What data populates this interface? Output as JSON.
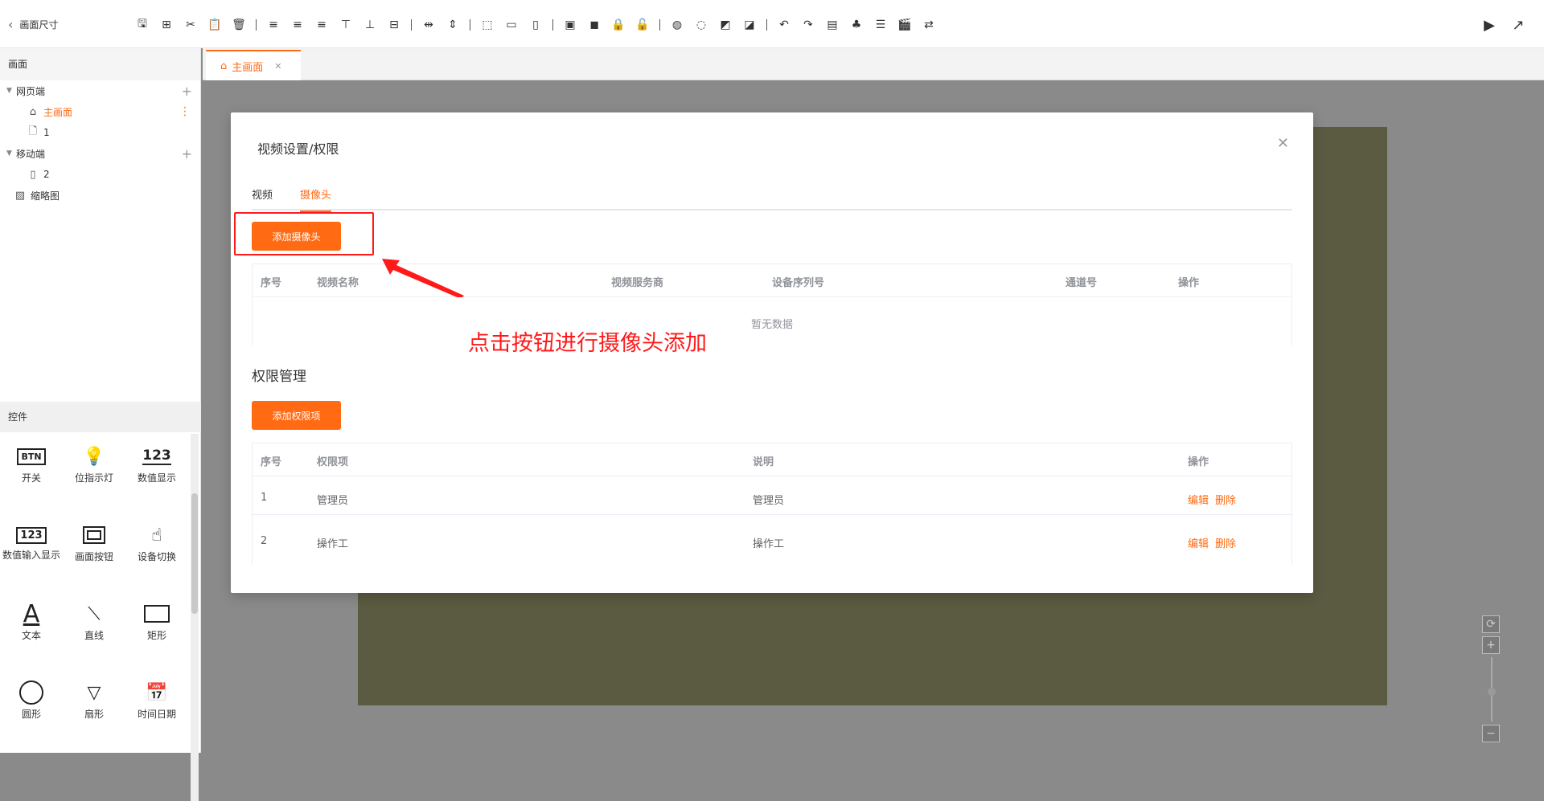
{
  "toolbar": {
    "back_label": "画面尺寸"
  },
  "left_panel": {
    "pages_title": "画面",
    "tree": {
      "web_label": "网页端",
      "main_page_label": "主画面",
      "page1_label": "1",
      "mobile_label": "移动端",
      "mobile_page_label": "2",
      "thumbnail_label": "缩略图"
    },
    "controls_title": "控件",
    "controls": [
      {
        "label": "开关",
        "icon": "btn-icon"
      },
      {
        "label": "位指示灯",
        "icon": "bulb-icon"
      },
      {
        "label": "数值显示",
        "icon": "number-display-icon"
      },
      {
        "label": "数值输入显示",
        "icon": "number-input-icon"
      },
      {
        "label": "画面按钮",
        "icon": "screen-button-icon"
      },
      {
        "label": "设备切换",
        "icon": "device-switch-icon"
      },
      {
        "label": "文本",
        "icon": "text-icon"
      },
      {
        "label": "直线",
        "icon": "line-icon"
      },
      {
        "label": "矩形",
        "icon": "rect-icon"
      },
      {
        "label": "圆形",
        "icon": "circle-icon"
      },
      {
        "label": "扇形",
        "icon": "sector-icon"
      },
      {
        "label": "时间日期",
        "icon": "datetime-icon"
      }
    ]
  },
  "tabstrip": {
    "main_tab": "主画面"
  },
  "modal": {
    "title": "视频设置/权限",
    "tabs": [
      "视频",
      "摄像头"
    ],
    "active_tab": "摄像头",
    "add_camera_label": "添加摄像头",
    "camera_table": {
      "headers": [
        "序号",
        "视频名称",
        "视频服务商",
        "设备序列号",
        "通道号",
        "操作"
      ],
      "empty_text": "暂无数据"
    },
    "permission_section_title": "权限管理",
    "add_permission_label": "添加权限项",
    "permission_table": {
      "headers": [
        "序号",
        "权限项",
        "说明",
        "操作"
      ],
      "rows": [
        {
          "index": "1",
          "item": "管理员",
          "desc": "管理员",
          "edit": "编辑",
          "delete": "删除"
        },
        {
          "index": "2",
          "item": "操作工",
          "desc": "操作工",
          "edit": "编辑",
          "delete": "删除"
        }
      ]
    }
  },
  "annotation": {
    "text": "点击按钮进行摄像头添加",
    "color": "#ff1a1a"
  },
  "colors": {
    "accent": "#ff6a13",
    "canvas": "#5b5b42"
  }
}
